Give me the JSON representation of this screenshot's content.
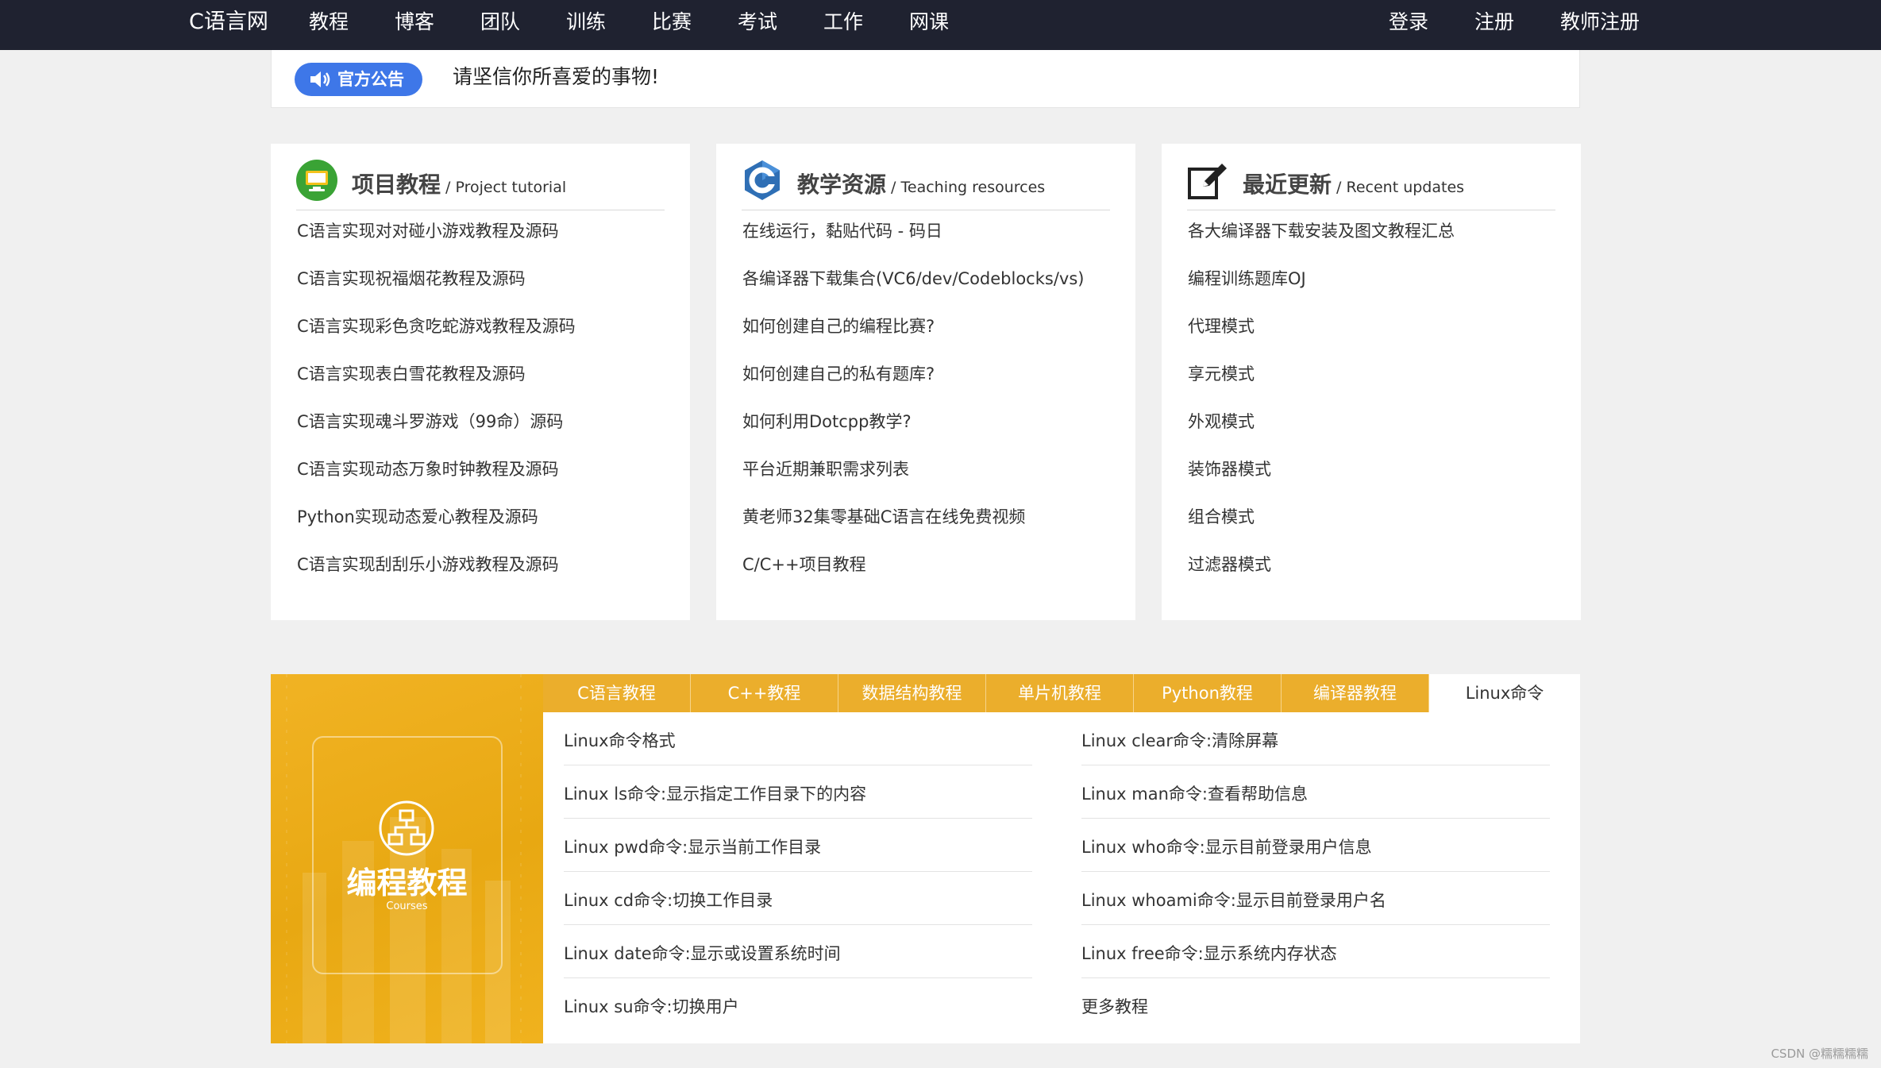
{
  "nav": {
    "brand": "C语言网",
    "items": [
      "教程",
      "博客",
      "团队",
      "训练",
      "比赛",
      "考试",
      "工作",
      "网课"
    ],
    "right": [
      "登录",
      "注册",
      "教师注册"
    ]
  },
  "announcement": {
    "badge": "官方公告",
    "text": "请坚信你所喜爱的事物!"
  },
  "cards": [
    {
      "title": "项目教程",
      "subtitle": " / Project tutorial",
      "icon": "monitor-icon",
      "items": [
        "C语言实现对对碰小游戏教程及源码",
        "C语言实现祝福烟花教程及源码",
        "C语言实现彩色贪吃蛇游戏教程及源码",
        "C语言实现表白雪花教程及源码",
        "C语言实现魂斗罗游戏（99命）源码",
        "C语言实现动态万象时钟教程及源码",
        "Python实现动态爱心教程及源码",
        "C语言实现刮刮乐小游戏教程及源码"
      ]
    },
    {
      "title": "教学资源",
      "subtitle": " / Teaching resources",
      "icon": "c-language-icon",
      "items": [
        "在线运行，黏贴代码 - 码日",
        "各编译器下载集合(VC6/dev/Codeblocks/vs)",
        "如何创建自己的编程比赛?",
        "如何创建自己的私有题库?",
        "如何利用Dotcpp教学?",
        "平台近期兼职需求列表",
        "黄老师32集零基础C语言在线免费视频",
        "C/C++项目教程"
      ]
    },
    {
      "title": "最近更新",
      "subtitle": " / Recent updates",
      "icon": "edit-icon",
      "items": [
        "各大编译器下载安装及图文教程汇总",
        "编程训练题库OJ",
        "代理模式",
        "享元模式",
        "外观模式",
        "装饰器模式",
        "组合模式",
        "过滤器模式"
      ]
    }
  ],
  "courses": {
    "banner_title": "编程教程",
    "banner_sub": "Courses",
    "tabs": [
      "C语言教程",
      "C++教程",
      "数据结构教程",
      "单片机教程",
      "Python教程",
      "编译器教程",
      "Linux命令"
    ],
    "active_tab": "Linux命令",
    "left_links": [
      "Linux命令格式",
      "Linux ls命令:显示指定工作目录下的内容",
      "Linux pwd命令:显示当前工作目录",
      "Linux cd命令:切换工作目录",
      "Linux date命令:显示或设置系统时间",
      "Linux su命令:切换用户"
    ],
    "right_links": [
      "Linux clear命令:清除屏幕",
      "Linux man命令:查看帮助信息",
      "Linux who命令:显示目前登录用户信息",
      "Linux whoami命令:显示目前登录用户名",
      "Linux free命令:显示系统内存状态",
      "更多教程"
    ]
  },
  "watermark": "CSDN @糯糯糯糯",
  "colors": {
    "nav_bg": "#1f2230",
    "badge": "#3e77e8",
    "tab": "#ebae2c",
    "banner": "#e8a812"
  }
}
